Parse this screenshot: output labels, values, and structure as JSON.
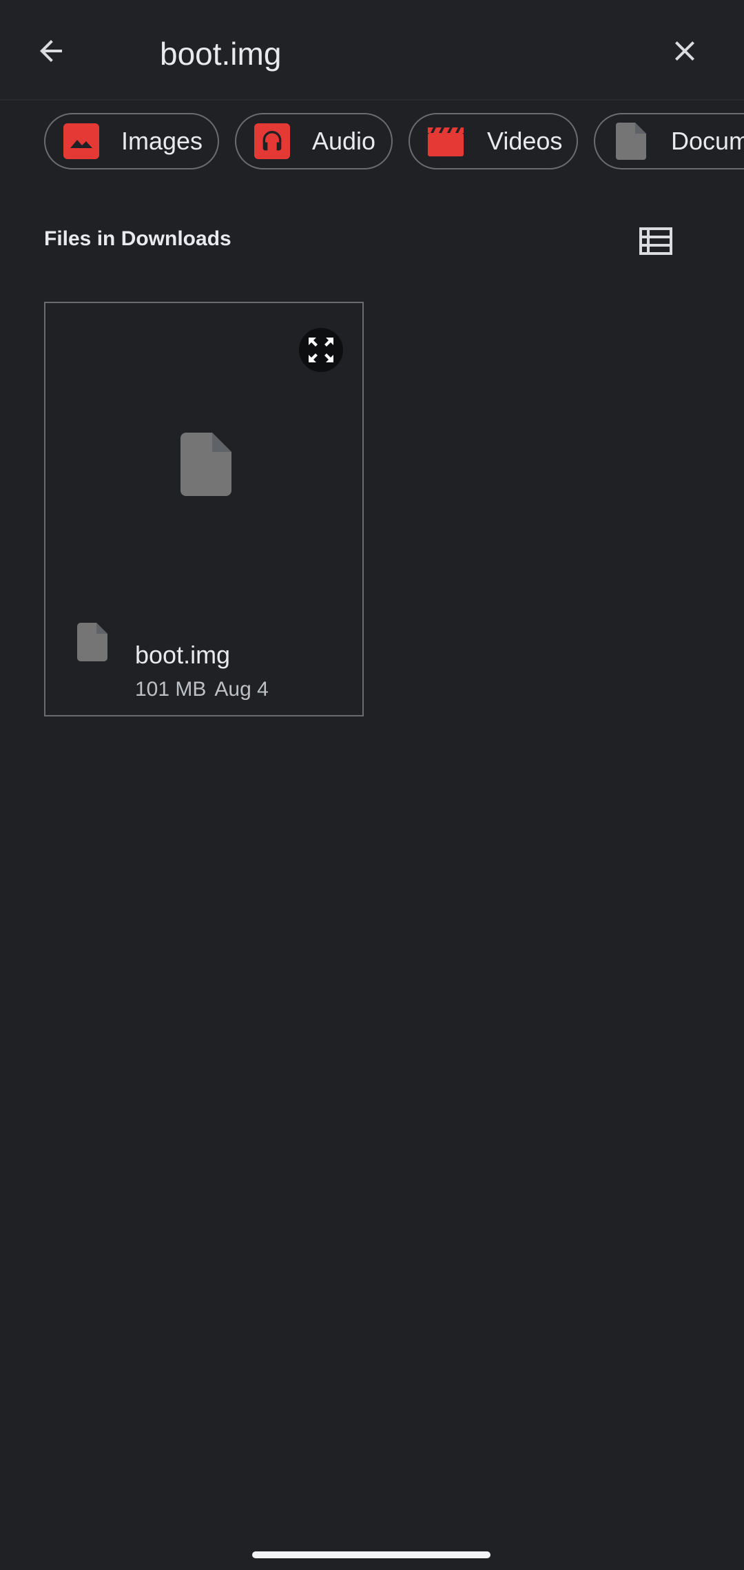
{
  "search": {
    "query": "boot.img"
  },
  "icons": {
    "back": "arrow-back-icon",
    "close": "close-icon",
    "images": "image-icon",
    "audio": "headphones-icon",
    "videos": "clapperboard-icon",
    "documents": "document-icon",
    "view_toggle": "list-view-icon",
    "expand": "fullscreen-icon",
    "file": "generic-file-icon"
  },
  "chips": [
    {
      "label": "Images",
      "icon_color": "#e53935"
    },
    {
      "label": "Audio",
      "icon_color": "#e53935"
    },
    {
      "label": "Videos",
      "icon_color": "#e53935"
    },
    {
      "label": "Documents",
      "icon_color": "#757575"
    }
  ],
  "section": {
    "title": "Files in Downloads"
  },
  "files": [
    {
      "name": "boot.img",
      "size": "101 MB",
      "date": "Aug 4"
    }
  ],
  "colors": {
    "background": "#202124",
    "accent_red": "#e53935",
    "file_icon_gray": "#757575",
    "text_primary": "#e8eaed",
    "text_secondary": "#bdc1c6"
  }
}
